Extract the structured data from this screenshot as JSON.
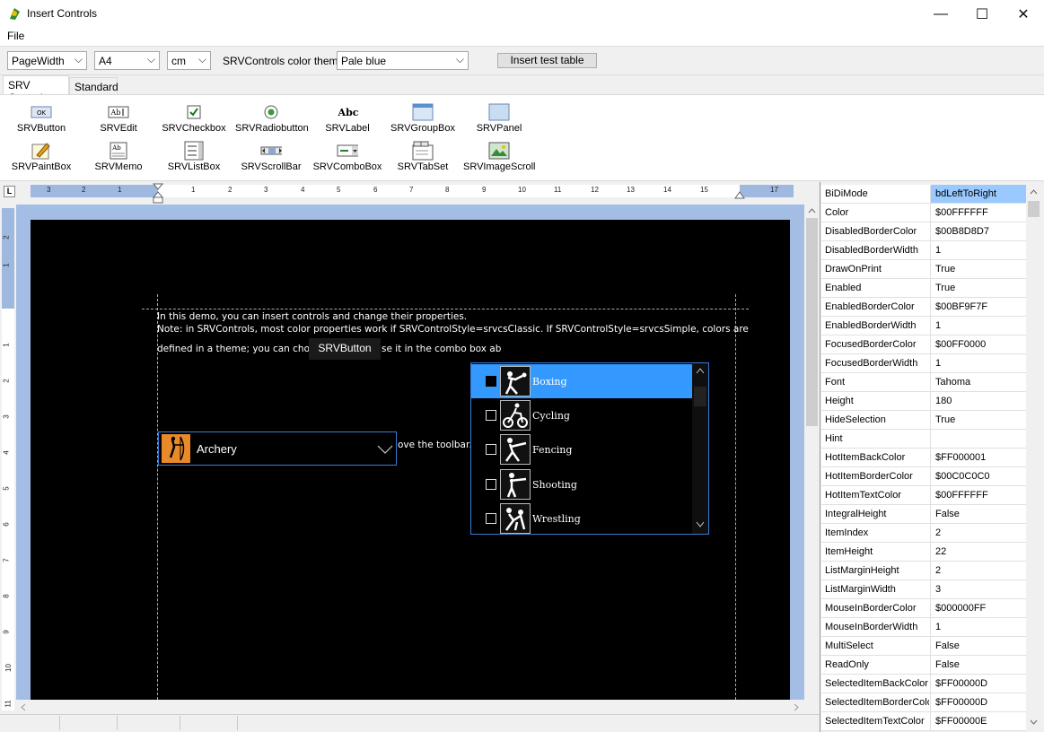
{
  "window": {
    "title": "Insert Controls",
    "minimize": "—",
    "maximize": "☐",
    "close": "✕"
  },
  "menu": {
    "file": "File"
  },
  "toolbar": {
    "zoom": "PageWidth",
    "paper": "A4",
    "units": "cm",
    "theme_label": "SRVControls color theme:",
    "theme": "Pale blue",
    "insert_table": "Insert test table"
  },
  "tabs": [
    {
      "label": "SRV Controls"
    },
    {
      "label": "Standard"
    }
  ],
  "palette": [
    {
      "label": "SRVButton",
      "icon": "button-icon"
    },
    {
      "label": "SRVEdit",
      "icon": "edit-icon"
    },
    {
      "label": "SRVCheckbox",
      "icon": "checkbox-icon"
    },
    {
      "label": "SRVRadiobutton",
      "icon": "radio-icon"
    },
    {
      "label": "SRVLabel",
      "icon": "label-icon"
    },
    {
      "label": "SRVGroupBox",
      "icon": "groupbox-icon"
    },
    {
      "label": "SRVPanel",
      "icon": "panel-icon"
    },
    {
      "label": "SRVPaintBox",
      "icon": "paintbox-icon"
    },
    {
      "label": "SRVMemo",
      "icon": "memo-icon"
    },
    {
      "label": "SRVListBox",
      "icon": "listbox-icon"
    },
    {
      "label": "SRVScrollBar",
      "icon": "scrollbar-icon"
    },
    {
      "label": "SRVComboBox",
      "icon": "combobox-icon"
    },
    {
      "label": "SRVTabSet",
      "icon": "tabset-icon"
    },
    {
      "label": "SRVImageScroll",
      "icon": "imagescroll-icon"
    }
  ],
  "ruler": {
    "corner": "L",
    "h_ticks": [
      "3",
      "2",
      "1",
      "1",
      "2",
      "3",
      "4",
      "5",
      "6",
      "7",
      "8",
      "9",
      "10",
      "11",
      "12",
      "13",
      "14",
      "15",
      "17"
    ],
    "v_ticks": [
      "2",
      "1",
      "1",
      "2",
      "3",
      "4",
      "5",
      "6",
      "7",
      "8",
      "9",
      "10",
      "11"
    ]
  },
  "document": {
    "line1": "In this demo, you can insert controls and change their properties.",
    "line2": "Note: in SRVControls, most color properties work if SRVControlStyle=srvcsClassic. If SRVControlStyle=srvcsSimple, colors are",
    "line3a": "defined in a theme; you can choo",
    "line3b": "se it in the combo box ab",
    "line4": "ove the toolbar.",
    "button": "SRVButton",
    "combo_value": "Archery",
    "list_items": [
      {
        "label": "Boxing",
        "selected": true
      },
      {
        "label": "Cycling",
        "selected": false
      },
      {
        "label": "Fencing",
        "selected": false
      },
      {
        "label": "Shooting",
        "selected": false
      },
      {
        "label": "Wrestling",
        "selected": false
      }
    ]
  },
  "properties": [
    {
      "name": "BiDiMode",
      "value": "bdLeftToRight"
    },
    {
      "name": "Color",
      "value": "$00FFFFFF"
    },
    {
      "name": "DisabledBorderColor",
      "value": "$00B8D8D7"
    },
    {
      "name": "DisabledBorderWidth",
      "value": "1"
    },
    {
      "name": "DrawOnPrint",
      "value": "True"
    },
    {
      "name": "Enabled",
      "value": "True"
    },
    {
      "name": "EnabledBorderColor",
      "value": "$00BF9F7F"
    },
    {
      "name": "EnabledBorderWidth",
      "value": "1"
    },
    {
      "name": "FocusedBorderColor",
      "value": "$00FF0000"
    },
    {
      "name": "FocusedBorderWidth",
      "value": "1"
    },
    {
      "name": "Font",
      "value": "Tahoma"
    },
    {
      "name": "Height",
      "value": "180"
    },
    {
      "name": "HideSelection",
      "value": "True"
    },
    {
      "name": "Hint",
      "value": ""
    },
    {
      "name": "HotItemBackColor",
      "value": "$FF000001"
    },
    {
      "name": "HotItemBorderColor",
      "value": "$00C0C0C0"
    },
    {
      "name": "HotItemTextColor",
      "value": "$00FFFFFF"
    },
    {
      "name": "IntegralHeight",
      "value": "False"
    },
    {
      "name": "ItemIndex",
      "value": "2"
    },
    {
      "name": "ItemHeight",
      "value": "22"
    },
    {
      "name": "ListMarginHeight",
      "value": "2"
    },
    {
      "name": "ListMarginWidth",
      "value": "3"
    },
    {
      "name": "MouseInBorderColor",
      "value": "$000000FF"
    },
    {
      "name": "MouseInBorderWidth",
      "value": "1"
    },
    {
      "name": "MultiSelect",
      "value": "False"
    },
    {
      "name": "ReadOnly",
      "value": "False"
    },
    {
      "name": "SelectedItemBackColor",
      "value": "$FF00000D"
    },
    {
      "name": "SelectedItemBorderColor",
      "value": "$FF00000D"
    },
    {
      "name": "SelectedItemTextColor",
      "value": "$FF00000E"
    }
  ],
  "colors": {
    "accent": "#3399ff",
    "page": "#000000",
    "doc_bg": "#a3bde5"
  }
}
